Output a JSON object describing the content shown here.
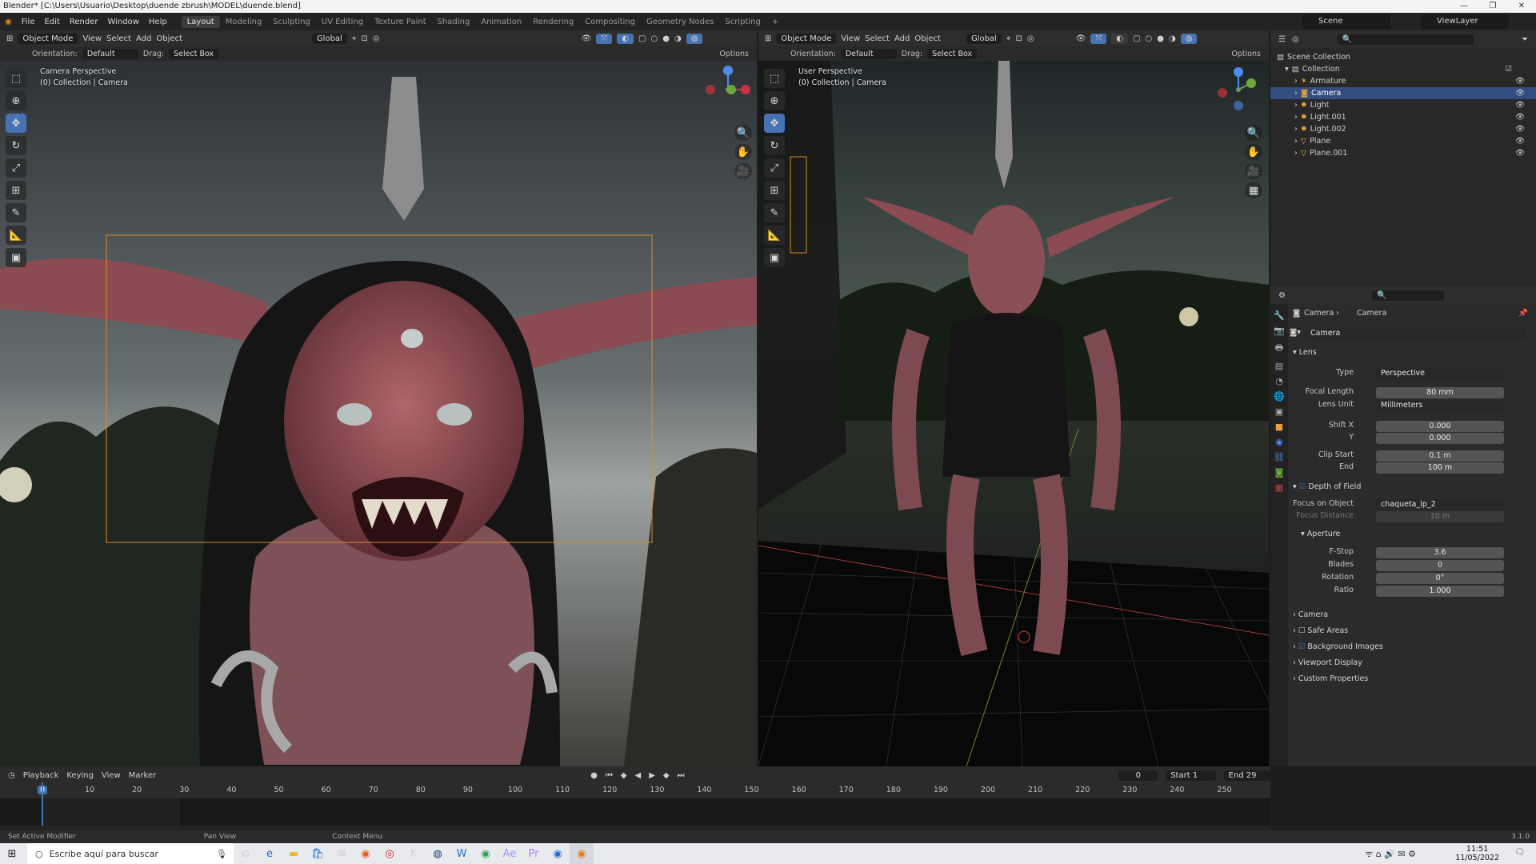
{
  "titlebar": {
    "title": "Blender* [C:\\Users\\Usuario\\Desktop\\duende zbrush\\MODEL\\duende.blend]"
  },
  "menu": {
    "items": [
      "File",
      "Edit",
      "Render",
      "Window",
      "Help"
    ]
  },
  "workspaces": [
    "Layout",
    "Modeling",
    "Sculpting",
    "UV Editing",
    "Texture Paint",
    "Shading",
    "Animation",
    "Rendering",
    "Compositing",
    "Geometry Nodes",
    "Scripting"
  ],
  "active_workspace": "Layout",
  "scene": {
    "name": "Scene",
    "view_layer": "ViewLayer"
  },
  "viewport_left": {
    "mode": "Object Mode",
    "menus": [
      "View",
      "Select",
      "Add",
      "Object"
    ],
    "transform": "Global",
    "orientation_label": "Orientation:",
    "orientation": "Default",
    "drag_label": "Drag:",
    "drag": "Select Box",
    "options": "Options",
    "overlay_title": "Camera Perspective",
    "overlay_sub": "(0) Collection | Camera"
  },
  "viewport_right": {
    "mode": "Object Mode",
    "menus": [
      "View",
      "Select",
      "Add",
      "Object"
    ],
    "transform": "Global",
    "orientation_label": "Orientation:",
    "orientation": "Default",
    "drag_label": "Drag:",
    "drag": "Select Box",
    "options": "Options",
    "overlay_title": "User Perspective",
    "overlay_sub": "(0) Collection | Camera"
  },
  "outliner": {
    "root": "Scene Collection",
    "collection": "Collection",
    "items": [
      "Armature",
      "Camera",
      "Light",
      "Light.001",
      "Light.002",
      "Plane",
      "Plane.001"
    ],
    "selected": "Camera"
  },
  "properties": {
    "breadcrumb": [
      "Camera",
      "Camera"
    ],
    "data_name": "Camera",
    "lens_header": "Lens",
    "type_label": "Type",
    "type_value": "Perspective",
    "focal_label": "Focal Length",
    "focal_value": "80 mm",
    "lens_unit_label": "Lens Unit",
    "lens_unit_value": "Millimeters",
    "shift_x_label": "Shift X",
    "shift_x_value": "0.000",
    "shift_y_label": "Y",
    "shift_y_value": "0.000",
    "clip_start_label": "Clip Start",
    "clip_start_value": "0.1 m",
    "clip_end_label": "End",
    "clip_end_value": "100 m",
    "dof_header": "Depth of Field",
    "focus_obj_label": "Focus on Object",
    "focus_obj_value": "chaqueta_lp_2",
    "focus_dist_label": "Focus Distance",
    "focus_dist_value": "10 m",
    "aperture_header": "Aperture",
    "fstop_label": "F-Stop",
    "fstop_value": "3.6",
    "blades_label": "Blades",
    "blades_value": "0",
    "rotation_label": "Rotation",
    "rotation_value": "0°",
    "ratio_label": "Ratio",
    "ratio_value": "1.000",
    "panels": [
      "Camera",
      "Safe Areas",
      "Background Images",
      "Viewport Display",
      "Custom Properties"
    ]
  },
  "timeline": {
    "menus": [
      "Playback",
      "Keying",
      "View",
      "Marker"
    ],
    "current_frame": "0",
    "start_label": "Start",
    "start": "1",
    "end_label": "End",
    "end": "29",
    "ticks": [
      "0",
      "10",
      "20",
      "30",
      "40",
      "50",
      "60",
      "70",
      "80",
      "90",
      "100",
      "110",
      "120",
      "130",
      "140",
      "150",
      "160",
      "170",
      "180",
      "190",
      "200",
      "210",
      "220",
      "230",
      "240",
      "250"
    ]
  },
  "statusbar": {
    "left": "Set Active Modifier",
    "mid": "Pan View",
    "right": "Context Menu",
    "version": "3.1.0"
  },
  "taskbar": {
    "search_placeholder": "Escribe aquí para buscar",
    "time": "11:51",
    "date": "11/05/2022"
  },
  "colors": {
    "accent": "#4772b3",
    "selected_row": "#334d80",
    "camera_frame": "#e08a2c"
  }
}
